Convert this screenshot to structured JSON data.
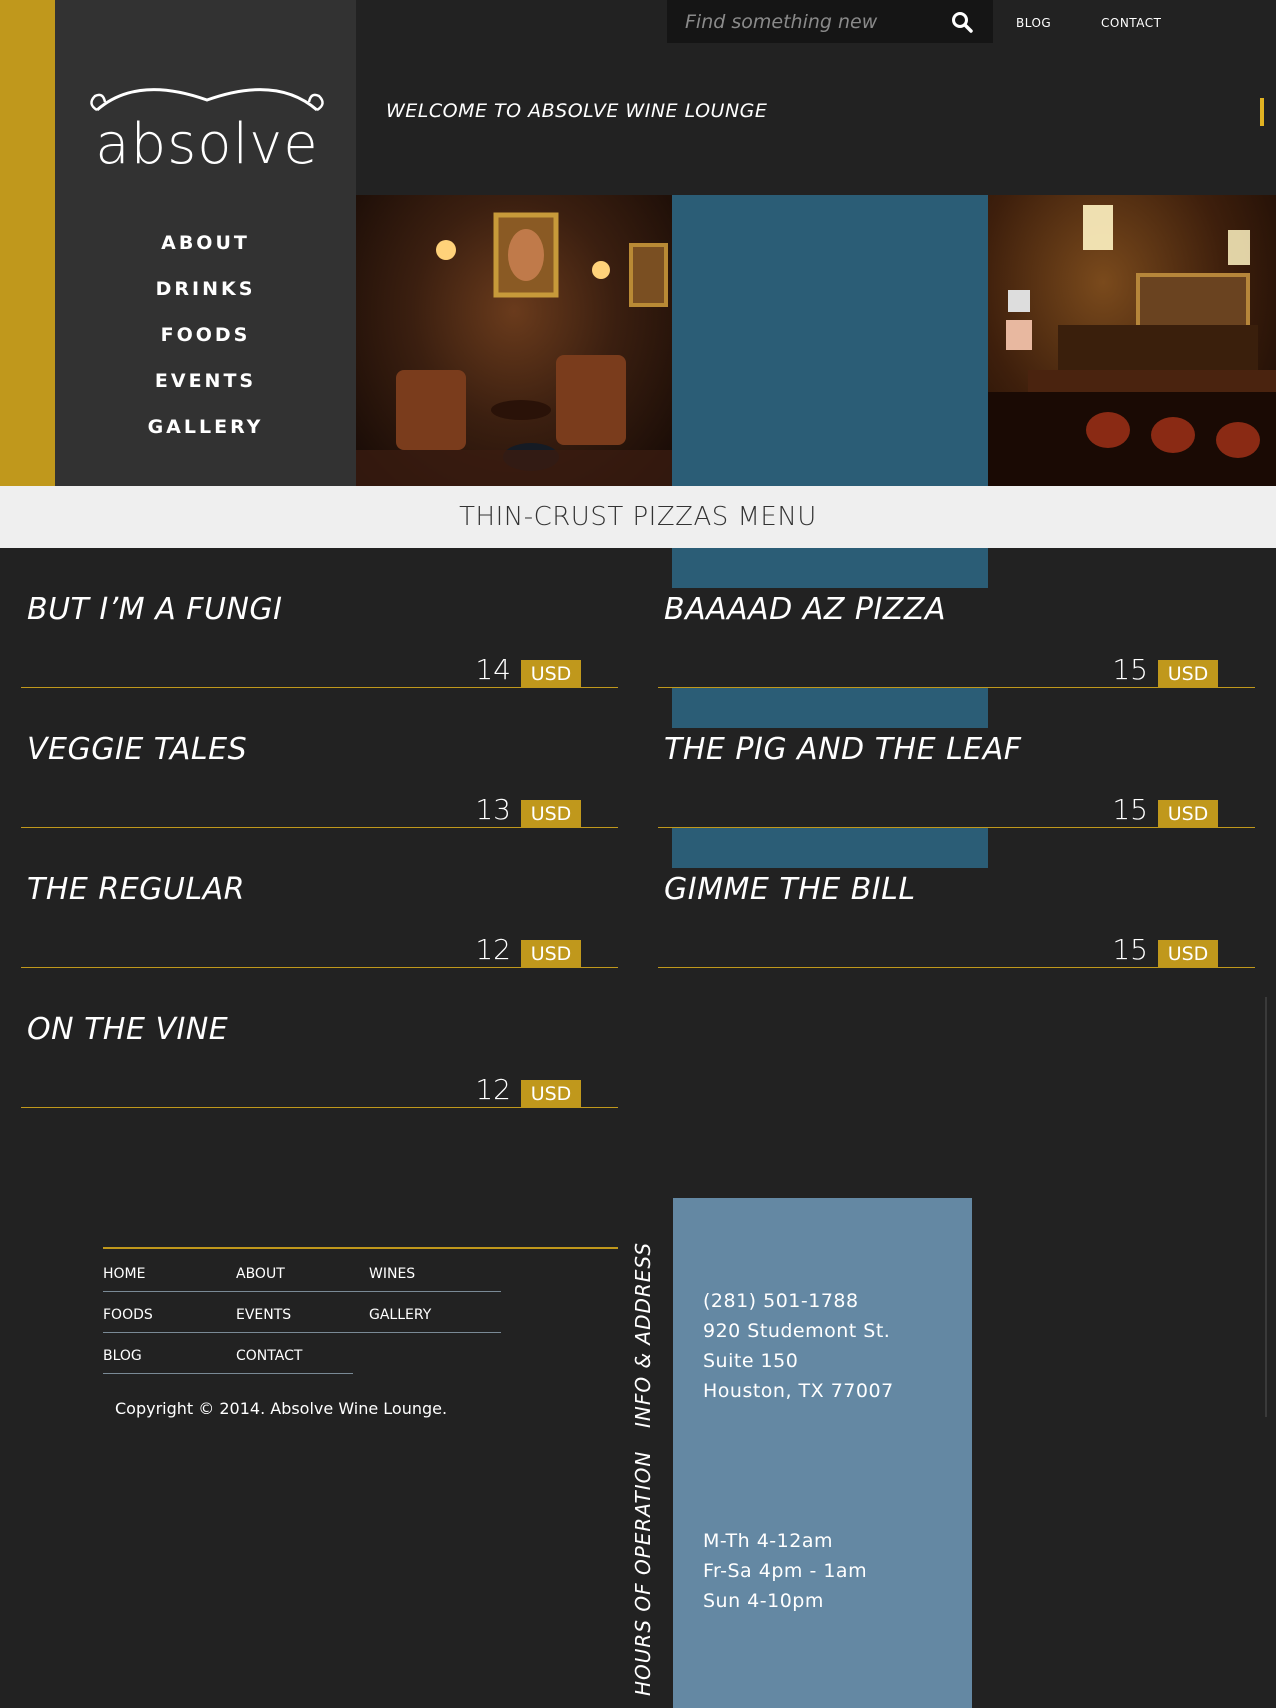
{
  "brand": {
    "logo_text": "absolve"
  },
  "nav": {
    "items": [
      "ABOUT",
      "DRINKS",
      "FOODS",
      "EVENTS",
      "GALLERY"
    ]
  },
  "header": {
    "search_placeholder": "Find something new",
    "blog_link": "BLOG",
    "contact_link": "CONTACT",
    "welcome": "WELCOME TO ABSOLVE WINE LOUNGE"
  },
  "menu": {
    "title": "THIN-CRUST PIZZAS MENU",
    "items": [
      {
        "name": "BUT I’M A FUNGI",
        "price": "14",
        "currency": "USD"
      },
      {
        "name": "BAAAAD AZ PIZZA",
        "price": "15",
        "currency": "USD"
      },
      {
        "name": "VEGGIE TALES",
        "price": "13",
        "currency": "USD"
      },
      {
        "name": "THE PIG AND THE LEAF",
        "price": "15",
        "currency": "USD"
      },
      {
        "name": "THE REGULAR",
        "price": "12",
        "currency": "USD"
      },
      {
        "name": "GIMME THE BILL",
        "price": "15",
        "currency": "USD"
      },
      {
        "name": "ON THE VINE",
        "price": "12",
        "currency": "USD"
      }
    ]
  },
  "footer": {
    "links": [
      [
        "HOME",
        "ABOUT",
        "WINES"
      ],
      [
        "FOODS",
        "EVENTS",
        "GALLERY"
      ],
      [
        "BLOG",
        "CONTACT"
      ]
    ],
    "copyright": "Copyright © 2014. Absolve Wine Lounge.",
    "info_label": "INFO & ADDRESS",
    "hours_label": "HOURS OF OPERATION",
    "address": [
      "(281) 501-1788",
      "920 Studemont St.",
      "Suite 150",
      "Houston, TX 77007"
    ],
    "hours": [
      "M-Th 4-12am",
      "Fr-Sa 4pm - 1am",
      "Sun 4-10pm"
    ]
  },
  "colors": {
    "gold": "#c0981c",
    "teal": "#2b5d76",
    "info_blue": "#6488a3",
    "background": "#222222",
    "sidebar": "#323232"
  }
}
